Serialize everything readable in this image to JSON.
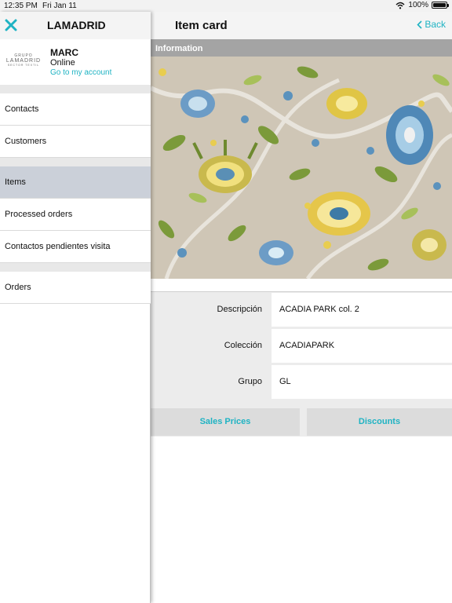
{
  "status_bar": {
    "time": "12:35 PM",
    "date": "Fri Jan 11",
    "battery": "100%"
  },
  "menu": {
    "brand": "LAMADRID",
    "logo": {
      "line1": "GRUPO",
      "line2": "LAMADRID",
      "line3": "SECTOR TEXTIL"
    },
    "user": {
      "name": "MARC",
      "status": "Online",
      "account_link": "Go to my account"
    },
    "items": [
      {
        "label": "Contacts"
      },
      {
        "label": "Customers"
      },
      {
        "label": "Items",
        "active": true
      },
      {
        "label": "Processed orders"
      },
      {
        "label": "Contactos pendientes visita"
      },
      {
        "label": "Orders"
      }
    ]
  },
  "content": {
    "title": "Item card",
    "back_label": "Back",
    "section_header": "Information",
    "fields": [
      {
        "label": "Descripción",
        "value": "ACADIA PARK col. 2"
      },
      {
        "label": "Colección",
        "value": "ACADIAPARK"
      },
      {
        "label": "Grupo",
        "value": "GL"
      }
    ],
    "buttons": {
      "sales_prices": "Sales Prices",
      "discounts": "Discounts"
    }
  },
  "colors": {
    "accent": "#1fb3c3",
    "active_menu": "#cbd0d9",
    "section_header": "#a4a4a4"
  }
}
